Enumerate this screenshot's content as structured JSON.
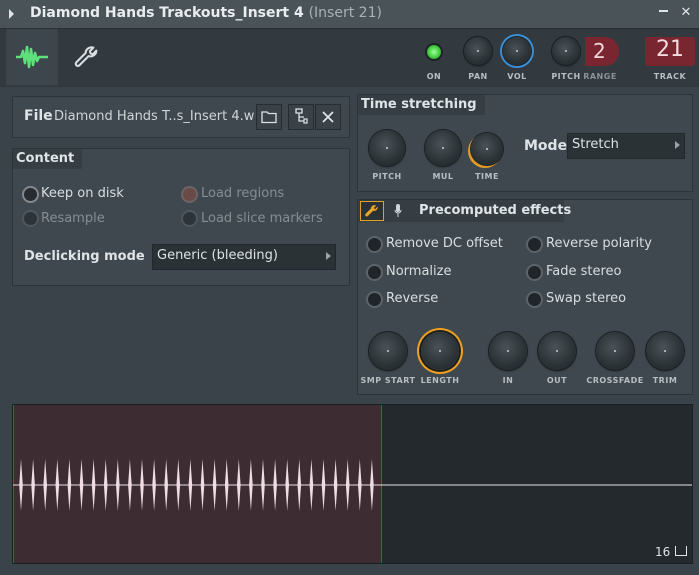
{
  "window": {
    "title": "Diamond Hands Trackouts_Insert 4",
    "subtitle": "(Insert 21)"
  },
  "toolbar": {
    "on_label": "ON",
    "pan_label": "PAN",
    "vol_label": "VOL",
    "pitch_label": "PITCH",
    "range_label": "RANGE",
    "range_value": "2",
    "track_label": "TRACK",
    "track_value": "21"
  },
  "file": {
    "label": "File",
    "filename": "Diamond Hands T..s_Insert 4.wav"
  },
  "content": {
    "title": "Content",
    "options": [
      {
        "label": "Keep on disk",
        "checked": true,
        "enabled": true
      },
      {
        "label": "Resample",
        "checked": false,
        "enabled": false
      },
      {
        "label": "Load regions",
        "checked": false,
        "enabled": false
      },
      {
        "label": "Load slice markers",
        "checked": false,
        "enabled": false
      }
    ],
    "declicking_label": "Declicking mode",
    "declicking_value": "Generic (bleeding)"
  },
  "time_stretching": {
    "title": "Time stretching",
    "knobs": [
      "PITCH",
      "MUL",
      "TIME"
    ],
    "mode_label": "Mode",
    "mode_value": "Stretch"
  },
  "precomputed": {
    "title": "Precomputed effects",
    "options": [
      "Remove DC offset",
      "Normalize",
      "Reverse",
      "Reverse polarity",
      "Fade stereo",
      "Swap stereo"
    ],
    "knobs": [
      "SMP START",
      "LENGTH",
      "IN",
      "OUT",
      "CROSSFADE",
      "TRIM"
    ]
  },
  "waveform": {
    "zoom_value": "16"
  },
  "colors": {
    "accent_green": "#5ee07a",
    "accent_blue": "#4fb0ff",
    "accent_orange": "#f0a020",
    "track_red": "#8b2a35"
  }
}
